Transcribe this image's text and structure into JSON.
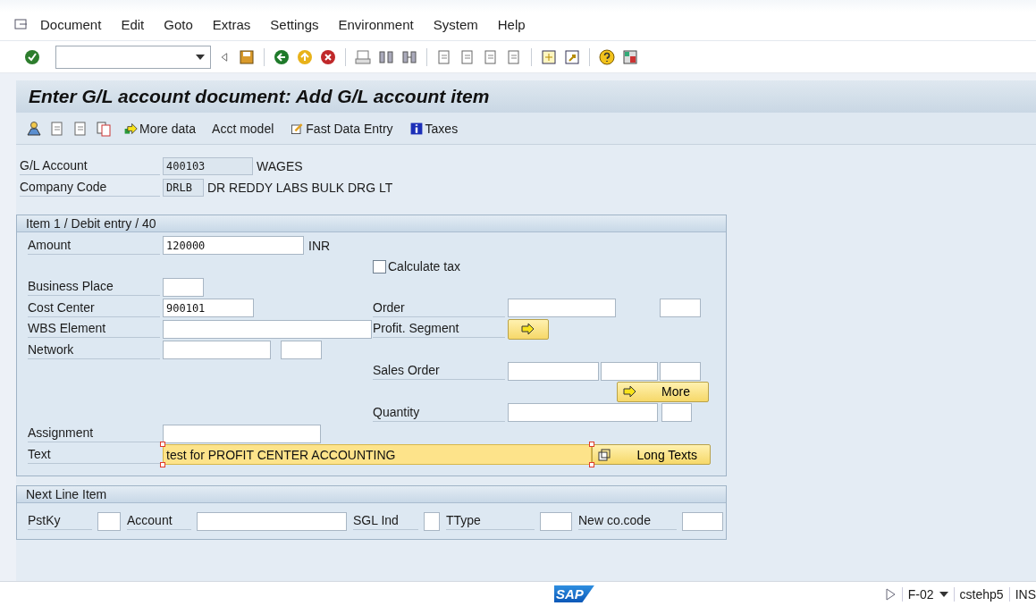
{
  "menu": [
    "Document",
    "Edit",
    "Goto",
    "Extras",
    "Settings",
    "Environment",
    "System",
    "Help"
  ],
  "title": "Enter G/L account document: Add G/L account item",
  "app_toolbar": [
    "More data",
    "Acct model",
    "Fast Data Entry",
    "Taxes"
  ],
  "header_fields": [
    {
      "label": "G/L Account",
      "value": "400103",
      "description": "WAGES"
    },
    {
      "label": "Company Code",
      "value": "DRLB",
      "description": "DR REDDY LABS BULK DRG LT"
    }
  ],
  "item_panel": {
    "title": "Item 1 / Debit entry / 40",
    "rows": [
      {
        "label": "Amount",
        "value": "120000",
        "unit": "INR"
      },
      {
        "right": {
          "kind": "checkbox",
          "label": "Calculate tax",
          "checked": false
        }
      },
      {
        "label": "Business Place"
      },
      {
        "label": "Cost Center",
        "value": "900101",
        "right": {
          "kind": "fields",
          "label": "Order"
        }
      },
      {
        "label": "WBS Element",
        "right": {
          "kind": "arrow_button",
          "label": "Profit. Segment"
        }
      },
      {
        "label": "Network"
      },
      {
        "right": {
          "kind": "fields",
          "label": "Sales Order"
        }
      },
      {
        "right": {
          "kind": "button",
          "label": "More"
        }
      },
      {
        "right": {
          "kind": "fields",
          "label": "Quantity"
        }
      },
      {
        "label": "Assignment"
      },
      {
        "label": "Text",
        "value": "test for PROFIT CENTER ACCOUNTING",
        "button": "Long Texts"
      }
    ]
  },
  "next_line_item": {
    "title": "Next Line Item",
    "fields": [
      {
        "label": "PstKy"
      },
      {
        "label": "Account"
      },
      {
        "label": "SGL Ind"
      },
      {
        "label": "TType"
      },
      {
        "label": "New co.code"
      }
    ]
  },
  "status_bar": {
    "logo": "SAP",
    "transaction": "F-02",
    "server": "cstehp5",
    "mode": "INS"
  }
}
